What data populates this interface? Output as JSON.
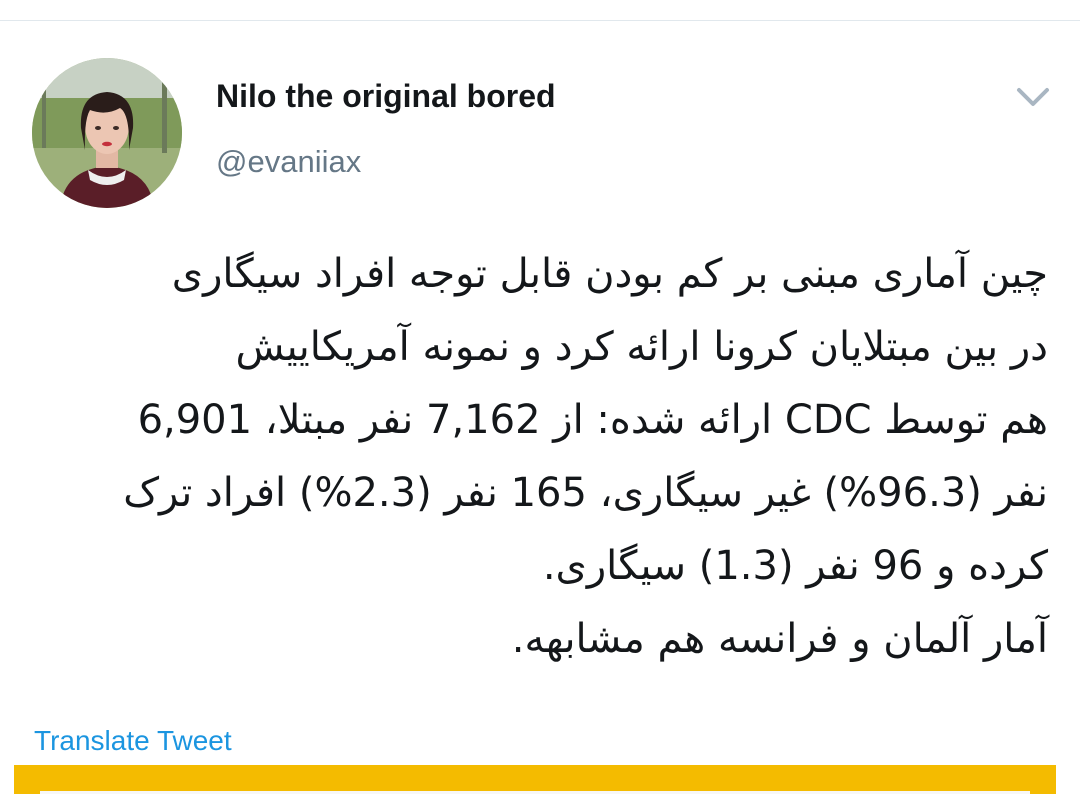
{
  "tweet": {
    "author": {
      "display_name": "Nilo the original bored",
      "handle": "@evaniiax",
      "avatar_icon": "profile-photo"
    },
    "menu_icon": "chevron-down-icon",
    "text_lines": [
      "چین آماری مبنی بر کم بودن قابل توجه افراد سیگاری",
      "در بین مبتلایان کرونا ارائه کرد و   نمونه آمریکاییش",
      "هم توسط CDC ارائه شده: از 7,162 نفر مبتلا، 6,901",
      "نفر (96.3%) غیر سیگاری، 165 نفر (2.3%) افراد ترک",
      "کرده و 96 نفر (1.3) سیگاری.",
      "آمار آلمان و فرانسه هم مشابهه."
    ],
    "translate_label": "Translate Tweet",
    "media_card_color": "#f4bb00",
    "link_color": "#1b95e0"
  }
}
